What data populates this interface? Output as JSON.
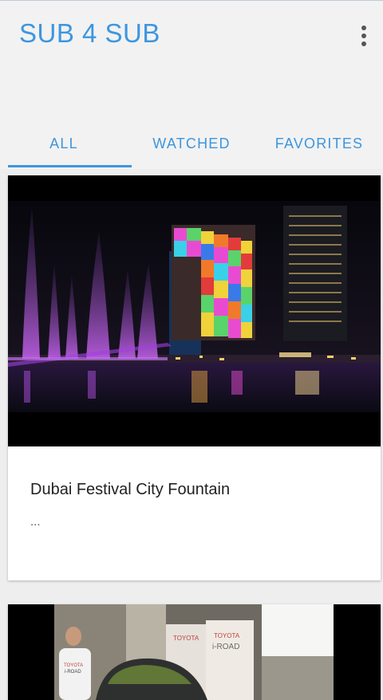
{
  "app": {
    "title": "SUB 4 SUB",
    "menu_icon": "more-vert-icon"
  },
  "tabs": [
    {
      "label": "ALL",
      "selected": true
    },
    {
      "label": "WATCHED",
      "selected": false
    },
    {
      "label": "FAVORITES",
      "selected": false
    }
  ],
  "videos": [
    {
      "title": "Dubai Festival City Fountain",
      "description": "..."
    },
    {
      "title": "",
      "description": ""
    }
  ],
  "colors": {
    "accent": "#3d96de",
    "background": "#eeeeee",
    "card": "#ffffff"
  }
}
